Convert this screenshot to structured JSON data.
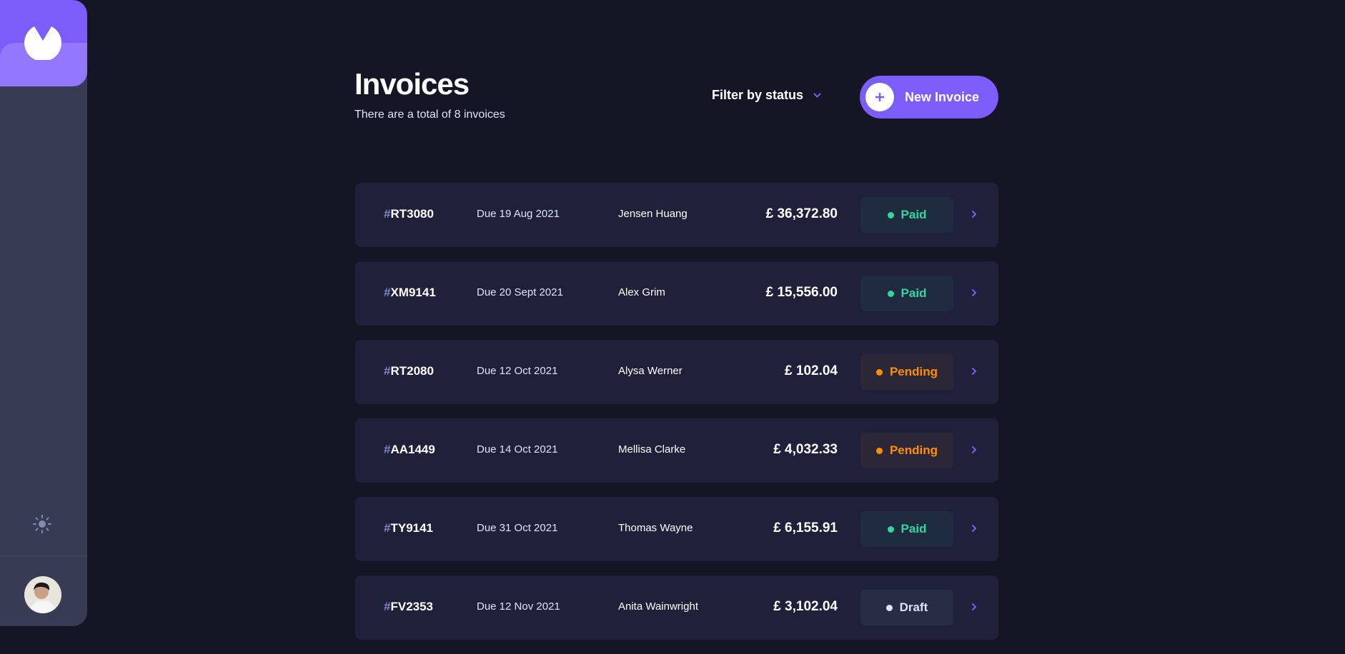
{
  "header": {
    "title": "Invoices",
    "subtitle": "There are a total of 8 invoices",
    "filter_label": "Filter by status",
    "new_invoice_label": "New Invoice"
  },
  "icons": {
    "logo": "logo-icon",
    "theme": "sun-icon",
    "filter": "chevron-down-icon",
    "new": "plus-icon",
    "row": "chevron-right-icon"
  },
  "colors": {
    "accent": "#7C5DFA",
    "paid": "#33D69F",
    "pending": "#FF8F00",
    "draft": "#DFE3FA"
  },
  "invoices": [
    {
      "hash": "#",
      "id": "RT3080",
      "due": "Due  19 Aug 2021",
      "client": "Jensen Huang",
      "amount": "£ 36,372.80",
      "status": "Paid"
    },
    {
      "hash": "#",
      "id": "XM9141",
      "due": "Due  20 Sept 2021",
      "client": "Alex Grim",
      "amount": "£ 15,556.00",
      "status": "Paid"
    },
    {
      "hash": "#",
      "id": "RT2080",
      "due": "Due  12 Oct 2021",
      "client": "Alysa Werner",
      "amount": "£ 102.04",
      "status": "Pending"
    },
    {
      "hash": "#",
      "id": "AA1449",
      "due": "Due  14 Oct 2021",
      "client": "Mellisa Clarke",
      "amount": "£ 4,032.33",
      "status": "Pending"
    },
    {
      "hash": "#",
      "id": "TY9141",
      "due": "Due  31 Oct 2021",
      "client": "Thomas Wayne",
      "amount": "£ 6,155.91",
      "status": "Paid"
    },
    {
      "hash": "#",
      "id": "FV2353",
      "due": "Due  12 Nov 2021",
      "client": "Anita Wainwright",
      "amount": "£ 3,102.04",
      "status": "Draft"
    }
  ]
}
